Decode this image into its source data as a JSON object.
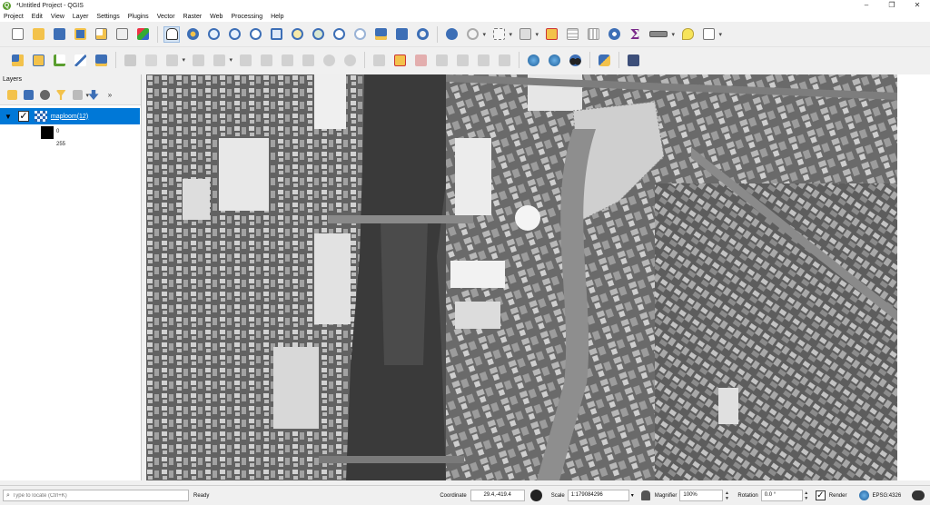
{
  "window": {
    "title": "*Untitled Project - QGIS",
    "logo_letter": "Q",
    "controls": [
      "–",
      "❐",
      "✕"
    ]
  },
  "menu": [
    "Project",
    "Edit",
    "View",
    "Layer",
    "Settings",
    "Plugins",
    "Vector",
    "Raster",
    "Web",
    "Processing",
    "Help"
  ],
  "toolbar_icons": {
    "row1": [
      "new-project-icon",
      "open-project-icon",
      "save-project-icon",
      "save-as-icon",
      "new-print-layout-icon",
      "layout-manager-icon",
      "style-manager-icon",
      "pan-icon",
      "pan-to-selection-icon",
      "zoom-in-icon",
      "zoom-out-icon",
      "zoom-native-icon",
      "zoom-full-icon",
      "zoom-selection-icon",
      "zoom-layer-icon",
      "zoom-last-icon",
      "zoom-next-icon",
      "new-bookmark-icon",
      "show-bookmarks-icon",
      "refresh-icon",
      "identify-icon",
      "select-features-icon",
      "deselect-icon",
      "open-attribute-table-icon",
      "toolbox-icon",
      "statistics-icon",
      "measure-icon",
      "map-tips-icon",
      "text-annotation-icon"
    ],
    "row2": [
      "data-source-manager-icon",
      "new-geopackage-layer-icon",
      "new-shapefile-layer-icon",
      "add-spatialite-icon",
      "new-temporary-layer-icon",
      "digitize-icon",
      "toggle-editing-icon",
      "save-edits-icon",
      "add-feature-icon",
      "vertex-tool-icon",
      "delete-selected-icon",
      "cut-features-icon",
      "copy-features-icon",
      "paste-features-icon",
      "undo-icon",
      "redo-icon",
      "label-tool-icon",
      "highlight-label-icon",
      "pin-label-icon",
      "show-hide-label-icon",
      "move-label-icon",
      "rotate-label-icon",
      "change-label-icon",
      "globe-icon",
      "globe-settings-icon",
      "binoculars-icon",
      "python-icon",
      "help-icon"
    ]
  },
  "layers_panel": {
    "title": "Layers",
    "layer_name": "maploom(12)",
    "legend": {
      "min_label": "0",
      "max_label": "255",
      "min_color": "#000000",
      "max_color": "#ffffff"
    }
  },
  "statusbar": {
    "locate_placeholder": "Type to locate (Ctrl+K)",
    "ready": "Ready",
    "coordinate_label": "Coordinate",
    "coordinate_value": "29.4,-419.4",
    "scale_label": "Scale",
    "scale_value": "1:179084296",
    "magnifier_label": "Magnifier",
    "magnifier_value": "100%",
    "rotation_label": "Rotation",
    "rotation_value": "0.0 °",
    "render_label": "Render",
    "crs": "EPSG:4326"
  },
  "colors": {
    "selection": "#0078d7",
    "map_background": "#4e4e4e",
    "qgis_green": "#5a9e2f"
  }
}
